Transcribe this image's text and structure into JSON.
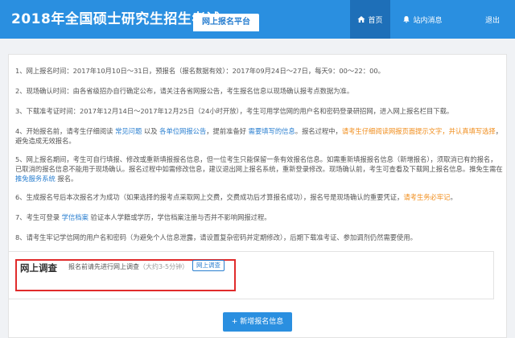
{
  "header": {
    "site_title": "2018年全国硕士研究生招生考试",
    "platform_tab": "网上报名平台",
    "nav": {
      "home": "首页",
      "messages": "站内消息",
      "logout": "退出"
    }
  },
  "notices": [
    {
      "t1": "1、网上报名时间：2017年10月10日～31日，预报名（报名数据有效）：2017年09月24日～27日，每天9：00～22：00。"
    },
    {
      "t1": "2、现场确认时间：由各省级招办自行确定公布，请关注各省网报公告，考生报名信息以现场确认报考点数据为准。"
    },
    {
      "t1": "3、下载准考证时间：2017年12月14日～2017年12月25日（24小时开放），考生可用学信网的用户名和密码登录研招网，进入网上报名栏目下载。"
    },
    {
      "t1": "4、开始报名前，请考生仔细阅读 ",
      "l1": "常见问题",
      "t2": " 以及 ",
      "l2": "各单位网报公告",
      "t3": "，提前准备好 ",
      "l3": "需要填写的信息",
      "t4": "。报名过程中，",
      "o1": "请考生仔细阅读网报页面提示文字，并认真填写选择",
      "t5": "，避免造成无效报名。"
    },
    {
      "t1": "5、网上报名期间，考生可自行填报、修改或重新填报报名信息，但一位考生只能保留一条有效报名信息。如需重新填报报名信息（新增报名），须取消已有的报名，已取消的报名信息不能用于现场确认。报名过程中如需修改信息，建议退出网上报名系统，重新登录修改。现场确认前，考生可查看及下载网上报名信息。推免生需在 ",
      "l1": "推免服务系统",
      "t2": " 报名。"
    },
    {
      "t1": "6、生成报名号后本次报名才为成功（如果选择的报考点采取网上交费，交费成功后才算报名成功），报名号是现场确认的重要凭证，",
      "o1": "请考生务必牢记",
      "t2": "。"
    },
    {
      "t1": "7、考生可登录 ",
      "l1": "学信档案",
      "t2": " 验证本人学籍或学历，学信档案注册与否并不影响网报过程。"
    },
    {
      "t1": "8、请考生牢记学信网的用户名和密码（为避免个人信息泄露，请设置复杂密码并定期修改），后期下载准考证、参加调剂仍然需要使用。"
    }
  ],
  "survey": {
    "title": "网上调查",
    "desc": "报名前请先进行网上调查",
    "hint": "（大约3-5分钟）",
    "button": "网上调查"
  },
  "add_button": "+ 新增报名信息"
}
